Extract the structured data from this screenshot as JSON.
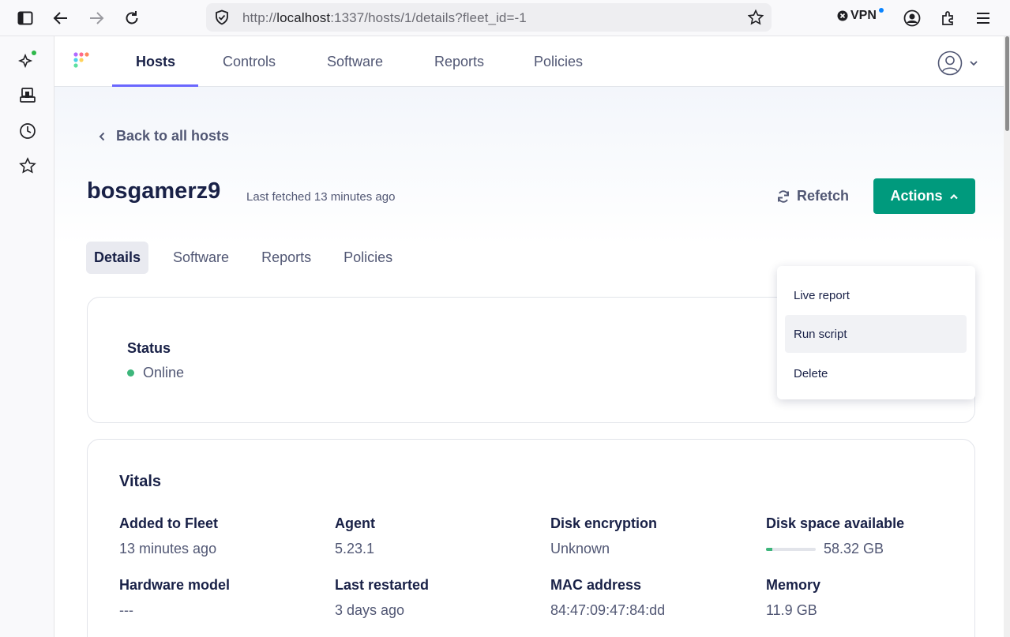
{
  "browser": {
    "url_prefix": "http://",
    "url_host": "localhost",
    "url_rest": ":1337/hosts/1/details?fleet_id=-1",
    "vpn_label": "VPN"
  },
  "nav": {
    "items": [
      {
        "label": "Hosts",
        "active": true
      },
      {
        "label": "Controls"
      },
      {
        "label": "Software"
      },
      {
        "label": "Reports"
      },
      {
        "label": "Policies"
      }
    ]
  },
  "page": {
    "back_label": "Back to all hosts",
    "host_name": "bosgamerz9",
    "last_fetched": "Last fetched 13 minutes ago",
    "refetch_label": "Refetch",
    "actions_label": "Actions"
  },
  "tabs": [
    "Details",
    "Software",
    "Reports",
    "Policies"
  ],
  "actions_menu": [
    "Live report",
    "Run script",
    "Delete"
  ],
  "status": {
    "label": "Status",
    "value": "Online",
    "color": "#3db67b"
  },
  "vitals": {
    "title": "Vitals",
    "items": [
      {
        "label": "Added to Fleet",
        "value": "13 minutes ago"
      },
      {
        "label": "Agent",
        "value": "5.23.1"
      },
      {
        "label": "Disk encryption",
        "value": "Unknown"
      },
      {
        "label": "Disk space available",
        "value": "58.32 GB",
        "fill_fraction": 0.12
      },
      {
        "label": "Hardware model",
        "value": "---"
      },
      {
        "label": "Last restarted",
        "value": "3 days ago"
      },
      {
        "label": "MAC address",
        "value": "84:47:09:47:84:dd"
      },
      {
        "label": "Memory",
        "value": "11.9 GB"
      }
    ]
  },
  "colors": {
    "accent": "#6a67fe",
    "primary_button": "#009a7d",
    "text_dark": "#192147",
    "text_muted": "#515774"
  }
}
